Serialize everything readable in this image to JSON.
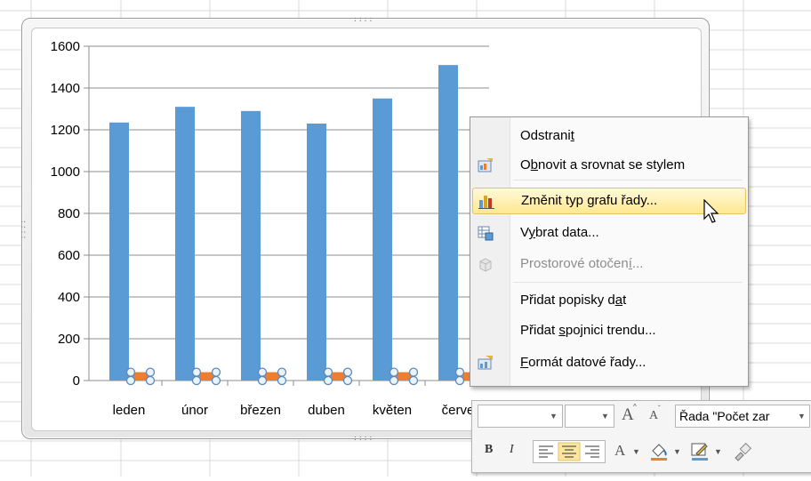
{
  "chart_data": {
    "type": "bar",
    "categories": [
      "leden",
      "únor",
      "březen",
      "duben",
      "květen",
      "červe"
    ],
    "series": [
      {
        "values": [
          1235,
          1310,
          1290,
          1230,
          1350,
          1510
        ],
        "color": "#5b9bd5"
      },
      {
        "values": [
          40,
          40,
          40,
          40,
          40,
          40
        ],
        "color": "#ed7d31",
        "selected": true
      }
    ],
    "y_ticks": [
      "0",
      "200",
      "400",
      "600",
      "800",
      "1000",
      "1200",
      "1400",
      "1600"
    ],
    "ylim": [
      0,
      1600
    ],
    "grid": true
  },
  "context_menu": {
    "items": [
      {
        "label": "Odstranit",
        "icon": "",
        "disabled": false
      },
      {
        "label": "Obnovit a srovnat se stylem",
        "icon": "reset-style-icon",
        "disabled": false
      },
      {
        "label": "Změnit typ grafu řady...",
        "icon": "chart-type-icon",
        "disabled": false,
        "highlighted": true
      },
      {
        "label": "Vybrat data...",
        "icon": "select-data-icon",
        "disabled": false
      },
      {
        "label": "Prostorové otočení...",
        "icon": "3d-rotation-icon",
        "disabled": true
      },
      {
        "label": "Přidat popisky dat",
        "icon": "",
        "disabled": false
      },
      {
        "label": "Přidat spojnici trendu...",
        "icon": "",
        "disabled": false
      },
      {
        "label": "Formát datové řady...",
        "icon": "format-series-icon",
        "disabled": false
      }
    ]
  },
  "mini_toolbar": {
    "font_name": "",
    "font_size": "",
    "grow_font": "A",
    "shrink_font": "A",
    "element_selector": "Řada \"Počet zar",
    "bold": "B",
    "italic": "I",
    "font_color_glyph": "A"
  }
}
